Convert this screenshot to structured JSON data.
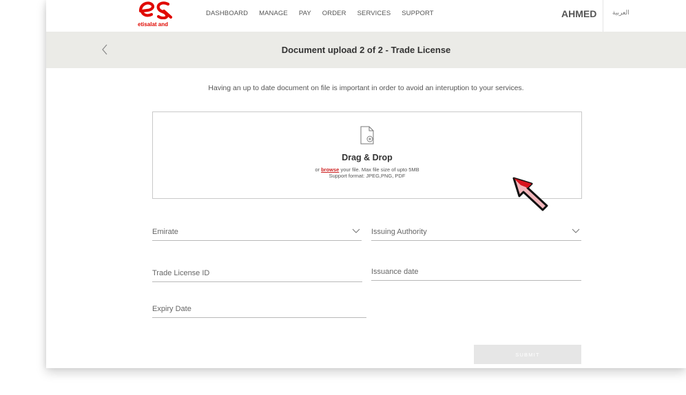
{
  "header": {
    "logo_text": "etisalat and",
    "nav": [
      "DASHBOARD",
      "MANAGE",
      "PAY",
      "ORDER",
      "SERVICES",
      "SUPPORT"
    ],
    "user_name": "AHMED",
    "language": "العربية"
  },
  "titlebar": {
    "title": "Document upload 2 of 2 - Trade License"
  },
  "info_text": "Having an up to date document on file is important in order to avoid an interuption to your services.",
  "dropzone": {
    "title": "Drag & Drop",
    "prefix": "or ",
    "browse_label": "browse",
    "suffix": " your file. Max file size of upto 5MB",
    "formats": "Support format: JPEG,PNG, PDF"
  },
  "form": {
    "emirate": "Emirate",
    "issuing_authority": "Issuing Authority",
    "trade_license_id": "Trade License ID",
    "issuance_date": "Issuance date",
    "expiry_date": "Expiry Date"
  },
  "submit_label": "SUBMIT",
  "colors": {
    "brand_red": "#e00800",
    "title_band": "#ebebe7",
    "submit_disabled": "#e6e6e6"
  }
}
